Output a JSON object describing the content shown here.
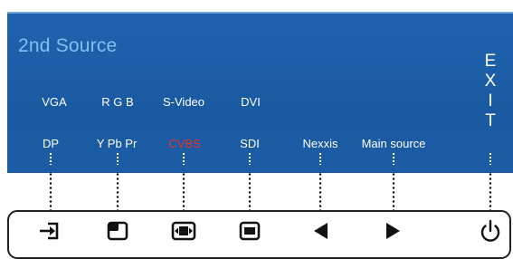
{
  "menu": {
    "title": "2nd Source",
    "row1": [
      "VGA",
      "R G B",
      "S-Video",
      "DVI"
    ],
    "row2": [
      "DP",
      "Y Pb Pr",
      "CVBS",
      "SDI",
      "Nexxis",
      "Main source"
    ],
    "selected": "CVBS",
    "exit_letters": [
      "E",
      "X",
      "I",
      "T"
    ]
  },
  "buttons": [
    {
      "name": "input-select-icon"
    },
    {
      "name": "pip-icon"
    },
    {
      "name": "aspect-ratio-icon"
    },
    {
      "name": "display-icon"
    },
    {
      "name": "left-arrow-icon"
    },
    {
      "name": "right-arrow-icon"
    },
    {
      "name": "power-icon"
    }
  ],
  "colors": {
    "osd_background": "#1a5aa2",
    "title": "#7ec0f2",
    "option_text": "#ffffff",
    "selected_option": "#e3362d"
  }
}
